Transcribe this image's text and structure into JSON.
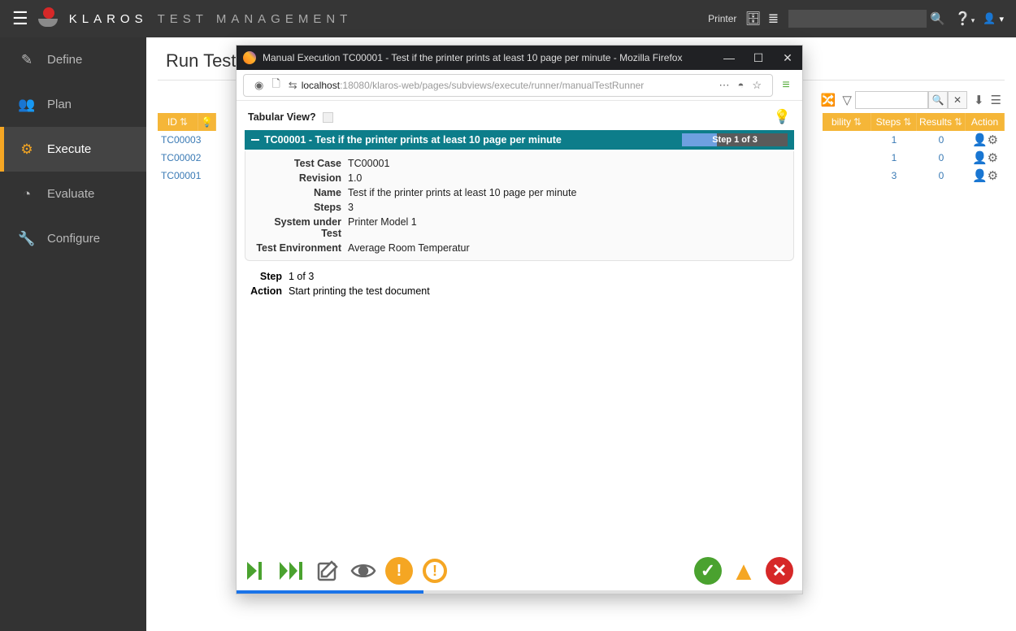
{
  "app": {
    "brand": "KLAROS",
    "subtitle": "TEST MANAGEMENT"
  },
  "top": {
    "project_label": "Printer",
    "search_placeholder": ""
  },
  "sidebar": {
    "items": [
      {
        "label": "Define"
      },
      {
        "label": "Plan"
      },
      {
        "label": "Execute"
      },
      {
        "label": "Evaluate"
      },
      {
        "label": "Configure"
      }
    ]
  },
  "page": {
    "title": "Run Test Ca"
  },
  "table": {
    "headers": {
      "id": "ID",
      "traceability": "bility",
      "steps": "Steps",
      "results": "Results",
      "action": "Action"
    },
    "rows": [
      {
        "id": "TC00003",
        "steps": "1",
        "results": "0"
      },
      {
        "id": "TC00002",
        "steps": "1",
        "results": "0"
      },
      {
        "id": "TC00001",
        "steps": "3",
        "results": "0"
      }
    ]
  },
  "popup": {
    "window_title": "Manual Execution TC00001 - Test if the printer prints at least 10 page per minute - Mozilla Firefox",
    "url_host": "localhost",
    "url_path": ":18080/klaros-web/pages/subviews/execute/runner/manualTestRunner",
    "tabular_label": "Tabular View?",
    "header_title": "TC00001 - Test if the printer prints at least 10 page per minute",
    "step_of": "Step 1 of 3",
    "meta": {
      "testcase_label": "Test Case",
      "testcase": "TC00001",
      "revision_label": "Revision",
      "revision": "1.0",
      "name_label": "Name",
      "name": "Test if the printer prints at least 10 page per minute",
      "steps_label": "Steps",
      "steps": "3",
      "sut_label": "System under Test",
      "sut": "Printer Model 1",
      "env_label": "Test Environment",
      "env": "Average Room Temperatur"
    },
    "step": {
      "label": "Step",
      "value": "1 of 3",
      "action_label": "Action",
      "action": "Start printing the test document"
    }
  }
}
